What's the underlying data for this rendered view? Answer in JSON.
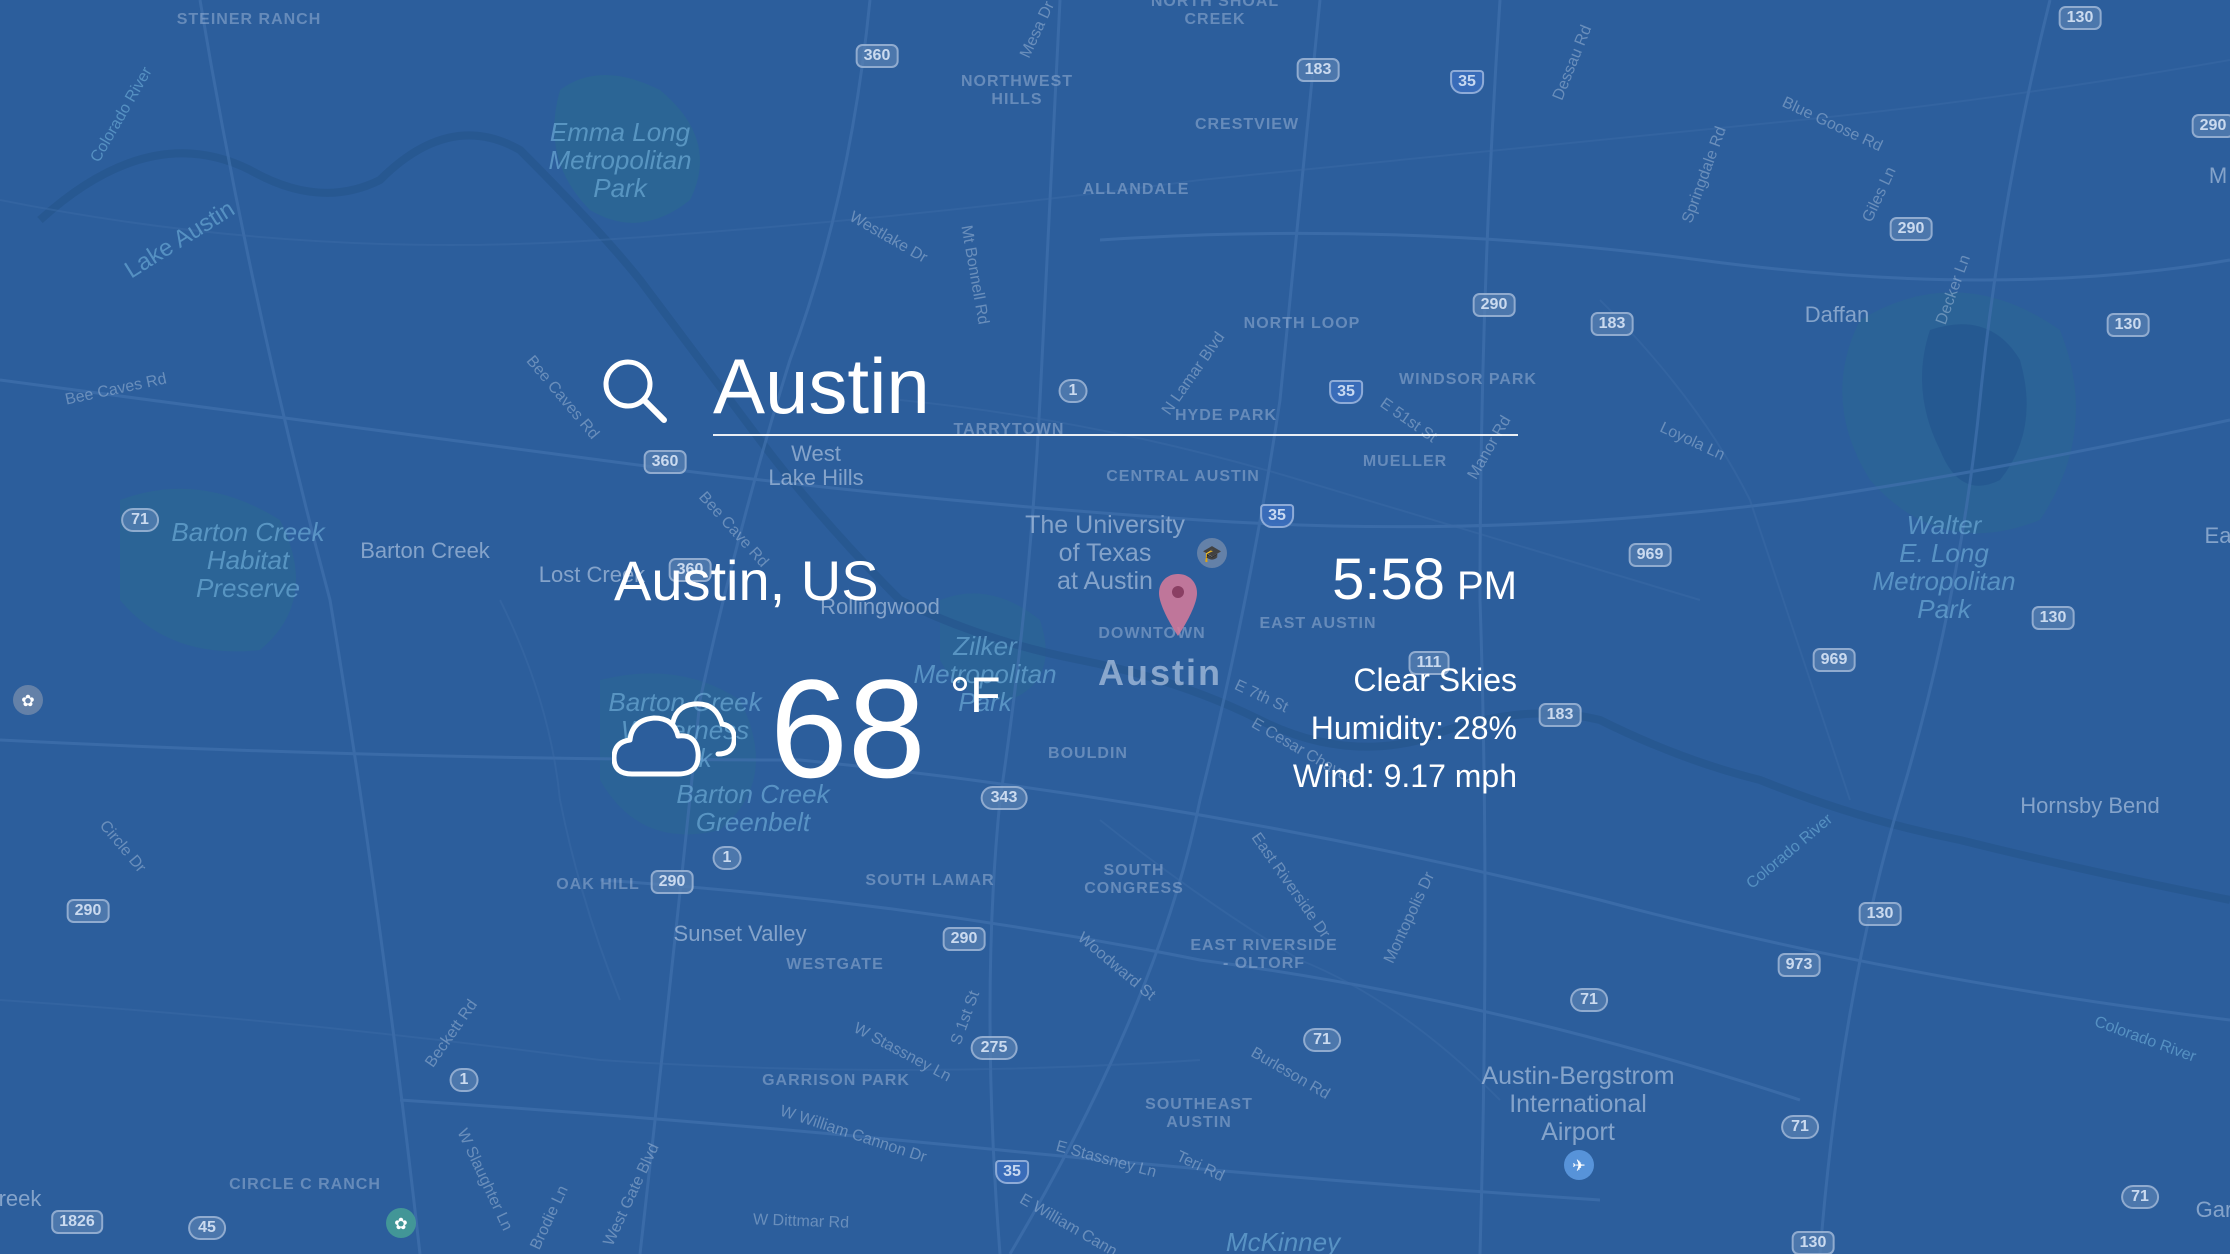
{
  "search": {
    "value": "Austin",
    "icon": "search-icon"
  },
  "location": {
    "name": "Austin, US"
  },
  "time": {
    "value": "5:58",
    "ampm": "PM"
  },
  "current": {
    "temperature": "68",
    "unit": "°F",
    "icon": "partly-cloudy-icon",
    "condition": "Clear Skies",
    "humidity": "Humidity: 28%",
    "wind": "Wind: 9.17 mph"
  },
  "map": {
    "neighborhoods": {
      "steiner_ranch": "STEINER RANCH",
      "northwest_hills": "NORTHWEST\nHILLS",
      "north_shoal_creek": "NORTH SHOAL\nCREEK",
      "crestview": "CRESTVIEW",
      "allandale": "ALLANDALE",
      "north_loop": "NORTH LOOP",
      "windsor_park": "WINDSOR PARK",
      "hyde_park": "HYDE PARK",
      "tarrytown": "TARRYTOWN",
      "central_austin": "CENTRAL AUSTIN",
      "mueller": "MUELLER",
      "east_austin": "EAST AUSTIN",
      "downtown": "DOWNTOWN",
      "bouldin": "BOULDIN",
      "oak_hill": "OAK HILL",
      "south_lamar": "SOUTH LAMAR",
      "south_congress": "SOUTH\nCONGRESS",
      "east_riverside": "EAST RIVERSIDE\n- OLTORF",
      "westgate": "WESTGATE",
      "garrison_park": "GARRISON PARK",
      "southeast_austin": "SOUTHEAST\nAUSTIN",
      "circle_c_ranch": "CIRCLE C RANCH"
    },
    "places": {
      "west_lake_hills": "West\nLake Hills",
      "barton_creek": "Barton Creek",
      "lost_creek": "Lost Creek",
      "rollingwood": "Rollingwood",
      "daffan": "Daffan",
      "hornsby_bend": "Hornsby Bend",
      "sunset_valley": "Sunset Valley",
      "ut_austin": "The University\nof Texas\nat Austin",
      "airport": "Austin-Bergstrom\nInternational\nAirport",
      "mckinney": "McKinney",
      "reek": "reek",
      "gar": "Gar",
      "ea": "Ea",
      "m": "M"
    },
    "parks": {
      "emma_long": "Emma Long\nMetropolitan\nPark",
      "barton_creek_habitat": "Barton Creek\nHabitat\nPreserve",
      "zilker": "Zilker\nMetropolitan\nPark",
      "barton_creek_wilderness": "Barton Creek\nWilderness\nPark",
      "barton_creek_greenbelt": "Barton Creek\nGreenbelt",
      "walter_e_long": "Walter\nE. Long\nMetropolitan\nPark"
    },
    "city": "Austin",
    "roads": {
      "mesa_dr": "Mesa Dr",
      "dessau_rd": "Dessau Rd",
      "blue_goose_rd": "Blue Goose Rd",
      "colorado_river": "Colorado River",
      "lake_austin": "Lake Austin",
      "westlake_dr": "Westlake Dr",
      "mt_bonnell_rd": "Mt Bonnell Rd",
      "springdale_rd": "Springdale Rd",
      "giles_ln": "Giles Ln",
      "decker_ln": "Decker Ln",
      "bee_caves_rd": "Bee Caves Rd",
      "bee_caves_rd2": "Bee Caves Rd",
      "n_lamar_blvd": "N Lamar Blvd",
      "e_51st_st": "E 51st St",
      "manor_rd": "Manor Rd",
      "loyola_ln": "Loyola Ln",
      "bee_cave_rd": "Bee Cave Rd",
      "e_7th_st": "E 7th St",
      "e_cesar_chavez": "E Cesar Chavez",
      "circle_dr": "Circle Dr",
      "east_riverside_dr": "East Riverside Dr",
      "montopolis_dr": "Montopolis Dr",
      "colorado_river2": "Colorado River",
      "woodward_st": "Woodward St",
      "beckett_rd": "Beckett Rd",
      "w_stassney_ln": "W Stassney Ln",
      "s_1st_st": "S 1st St",
      "burleson_rd": "Burleson Rd",
      "w_slaughter_ln": "W Slaughter Ln",
      "w_william_cannon": "W William Cannon Dr",
      "e_stassney_ln": "E Stassney Ln",
      "teri_rd": "Teri Rd",
      "brodie_ln": "Brodie Ln",
      "west_gate_blvd": "West Gate Blvd",
      "w_dittmar_rd": "W Dittmar Rd",
      "e_william_cannon": "E William Cann",
      "colorado_river3": "Colorado River"
    },
    "shields": {
      "s130a": "130",
      "s360a": "360",
      "s183a": "183",
      "i35a": "35",
      "s290a": "290",
      "s290b": "290",
      "s290c": "290",
      "s183b": "183",
      "s130b": "130",
      "s1a": "1",
      "i35b": "35",
      "s360b": "360",
      "s71a": "71",
      "i35c": "35",
      "s969a": "969",
      "s360c": "360",
      "s130c": "130",
      "s969b": "969",
      "s111": "111",
      "s183c": "183",
      "s343": "343",
      "s1b": "1",
      "s290d": "290",
      "s290e": "290",
      "s130d": "130",
      "s973": "973",
      "s71b": "71",
      "s71c": "71",
      "s275": "275",
      "s1c": "1",
      "s71d": "71",
      "i35d": "35",
      "s71e": "71",
      "s1826": "1826",
      "s45": "45",
      "s130e": "130",
      "s290f": "290"
    }
  },
  "colors": {
    "map_background": "#2c5e9c",
    "text": "#ffffff",
    "pin": "#e07a98"
  }
}
